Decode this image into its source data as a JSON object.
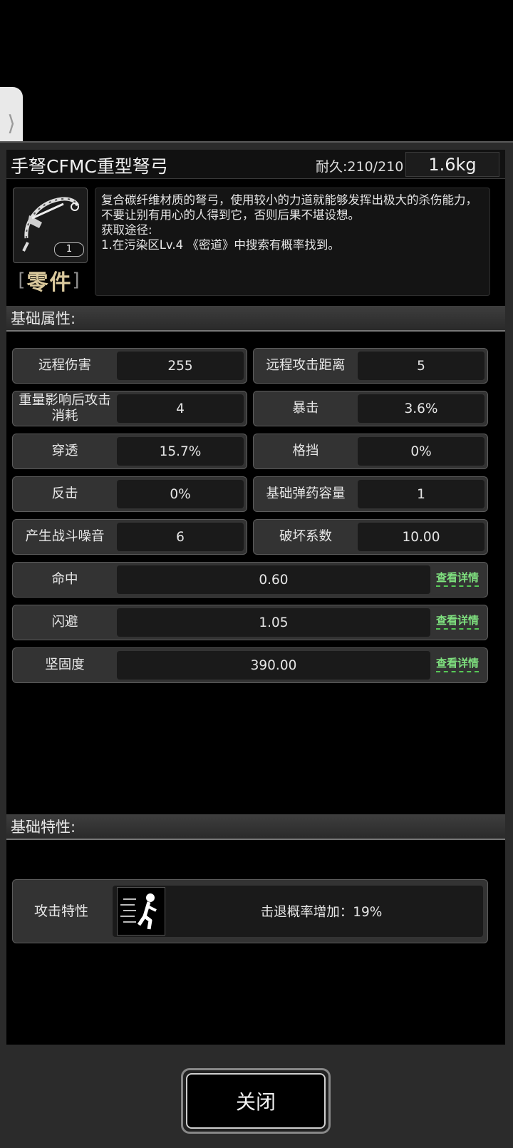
{
  "side_tab": {
    "glyph": "⟩"
  },
  "item": {
    "name": "手弩CFMC重型弩弓",
    "durability": "耐久:210/210",
    "weight": "1.6kg",
    "count": "1",
    "category": "零件",
    "category_left": "[",
    "category_right": "]",
    "description": "复合碳纤维材质的弩弓，使用较小的力道就能够发挥出极大的杀伤能力，不要让别有用心的人得到它，否则后果不堪设想。",
    "obtain_label": "获取途径:",
    "obtain_text": "1.在污染区Lv.4 《密道》中搜索有概率找到。",
    "icon": "crossbow-icon"
  },
  "basic_attributes": {
    "header": "基础属性:",
    "pairs": [
      [
        {
          "label": "远程伤害",
          "value": "255"
        },
        {
          "label": "远程攻击距离",
          "value": "5"
        }
      ],
      [
        {
          "label": "重量影响后攻击消耗",
          "value": "4"
        },
        {
          "label": "暴击",
          "value": "3.6%"
        }
      ],
      [
        {
          "label": "穿透",
          "value": "15.7%"
        },
        {
          "label": "格挡",
          "value": "0%"
        }
      ],
      [
        {
          "label": "反击",
          "value": "0%"
        },
        {
          "label": "基础弹药容量",
          "value": "1"
        }
      ],
      [
        {
          "label": "产生战斗噪音",
          "value": "6"
        },
        {
          "label": "破坏系数",
          "value": "10.00"
        }
      ]
    ],
    "wide": [
      {
        "label": "命中",
        "value": "0.60",
        "link": "查看详情"
      },
      {
        "label": "闪避",
        "value": "1.05",
        "link": "查看详情"
      },
      {
        "label": "坚固度",
        "value": "390.00",
        "link": "查看详情"
      }
    ]
  },
  "basic_traits": {
    "header": "基础特性:",
    "label": "攻击特性",
    "icon": "knockback-icon",
    "text": "击退概率增加：19%"
  },
  "close_button": "关闭"
}
